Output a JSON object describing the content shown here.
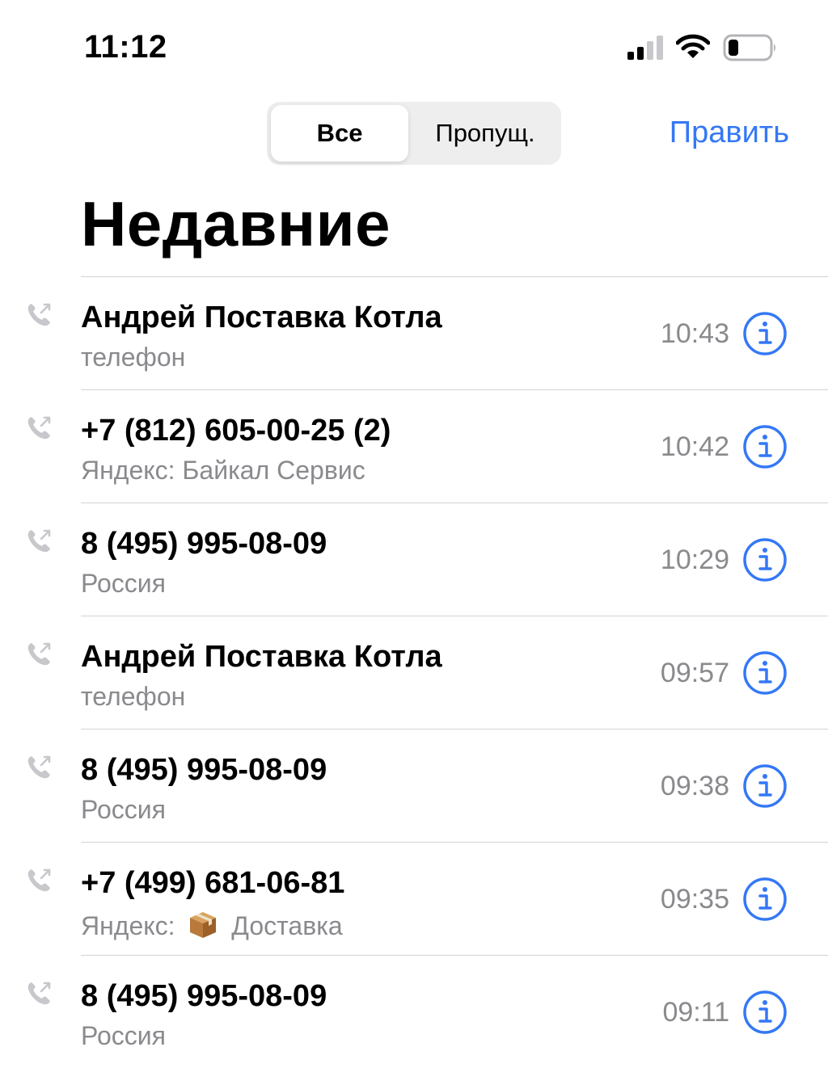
{
  "status_bar": {
    "time": "11:12",
    "icons": [
      "cellular-signal-icon",
      "wifi-icon",
      "battery-low-icon"
    ]
  },
  "segmented_control": {
    "options": [
      "Все",
      "Пропущ."
    ],
    "selected": "Все"
  },
  "header": {
    "edit_label": "Править",
    "title": "Недавние"
  },
  "colors": {
    "accent": "#3478f6",
    "secondary_text": "#8a8a8e",
    "separator": "#d3d3d6",
    "segment_bg": "#eeeeef"
  },
  "calls": [
    {
      "name": "Андрей Поставка Котла",
      "subtitle": "телефон",
      "time": "10:43"
    },
    {
      "name": "+7 (812) 605-00-25 (2)",
      "subtitle": "Яндекс: Байкал Сервис",
      "time": "10:42"
    },
    {
      "name": "8 (495) 995-08-09",
      "subtitle": "Россия",
      "time": "10:29"
    },
    {
      "name": "Андрей Поставка Котла",
      "subtitle": "телефон",
      "time": "09:57"
    },
    {
      "name": "8 (495) 995-08-09",
      "subtitle": "Россия",
      "time": "09:38"
    },
    {
      "name": "+7 (499) 681-06-81",
      "subtitle_prefix": "Яндекс:",
      "subtitle_icon": "package-emoji-icon",
      "subtitle_suffix": "Доставка",
      "time": "09:35"
    },
    {
      "name": "8 (495) 995-08-09",
      "subtitle": "Россия",
      "time": "09:11"
    }
  ]
}
